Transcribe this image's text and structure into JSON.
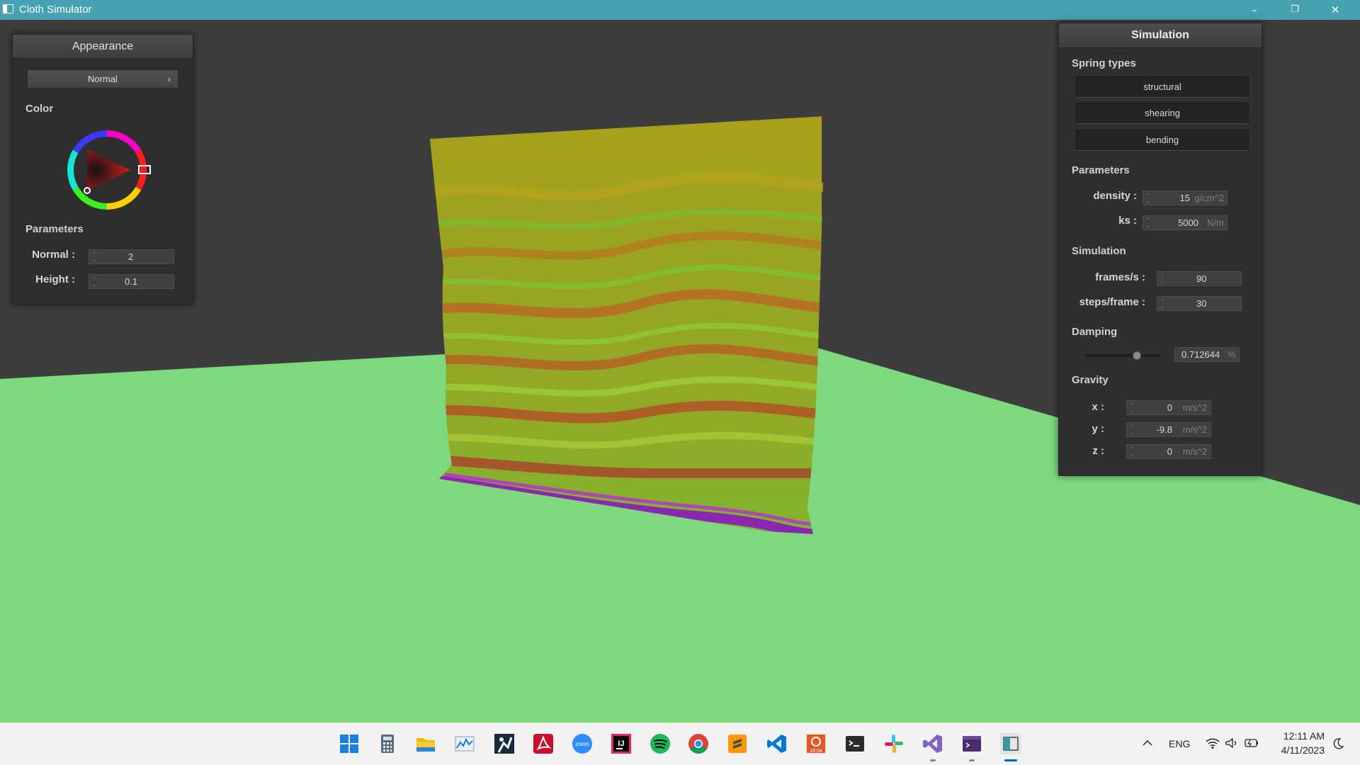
{
  "window": {
    "title": "Cloth Simulator",
    "controls": {
      "minimize": "–",
      "restore": "❐",
      "close": "✕"
    }
  },
  "appearance_panel": {
    "title": "Appearance",
    "mode_selector": {
      "value": "Normal",
      "chevron": "›"
    },
    "color_label": "Color",
    "parameters_label": "Parameters",
    "normal": {
      "label": "Normal :",
      "value": "2"
    },
    "height": {
      "label": "Height :",
      "value": "0.1"
    }
  },
  "simulation_panel": {
    "title": "Simulation",
    "spring_types_label": "Spring types",
    "spring_types": [
      "structural",
      "shearing",
      "bending"
    ],
    "parameters_label": "Parameters",
    "density": {
      "label": "density :",
      "value": "15",
      "unit": "g/cm^2"
    },
    "ks": {
      "label": "ks :",
      "value": "5000",
      "unit": "N/m"
    },
    "simulation_label": "Simulation",
    "frames_per_s": {
      "label": "frames/s :",
      "value": "90"
    },
    "steps_per_frame": {
      "label": "steps/frame :",
      "value": "30"
    },
    "damping_label": "Damping",
    "damping": {
      "value": "0.712644",
      "unit": "%",
      "level": 0.712644
    },
    "gravity_label": "Gravity",
    "gravity": {
      "x": {
        "label": "x :",
        "value": "0",
        "unit": "m/s^2"
      },
      "y": {
        "label": "y :",
        "value": "-9.8",
        "unit": "m/s^2"
      },
      "z": {
        "label": "z :",
        "value": "0",
        "unit": "m/s^2"
      }
    }
  },
  "scene": {
    "background_color": "#3d3d3d",
    "floor_color": "#7ed97e",
    "cloth_colors": [
      "#a3a31a",
      "#7cb12c",
      "#b86a1f",
      "#9a2ac2"
    ]
  },
  "taskbar": {
    "icons": [
      "windows-start",
      "calculator",
      "file-explorer",
      "performance-monitor",
      "jupyter",
      "acrobat-reader",
      "zoom",
      "intellij-idea",
      "spotify",
      "chrome",
      "sublime-text",
      "vscode",
      "ubuntu-18.04",
      "terminal",
      "slack",
      "visual-studio",
      "wsl-terminal",
      "cloth-simulator"
    ],
    "zoom_label": "zoom",
    "intellij_label": "IJ",
    "ubuntu_label": "18.04",
    "language": "ENG",
    "time": "12:11 AM",
    "date": "4/11/2023"
  }
}
